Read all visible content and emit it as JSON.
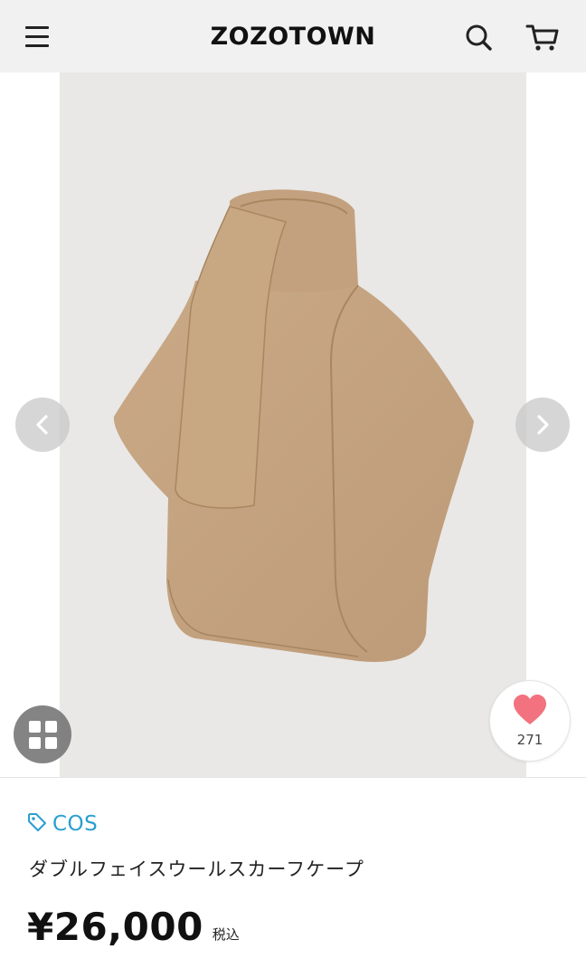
{
  "header": {
    "logo": "ZOZOTOWN",
    "menu_icon": "hamburger-menu-icon",
    "search_icon": "search-icon",
    "cart_icon": "cart-icon"
  },
  "gallery": {
    "prev_icon": "chevron-left-icon",
    "next_icon": "chevron-right-icon",
    "grid_icon": "grid-icon",
    "favorite_icon": "heart-icon",
    "favorite_count": "271",
    "photo_background": "#e9e8e6",
    "garment_color": "#c5a583"
  },
  "product": {
    "brand_icon": "tag-icon",
    "brand": "COS",
    "brand_color": "#2a9fd0",
    "name": "ダブルフェイスウールスカーフケープ",
    "price": "¥26,000",
    "tax_label": "税込"
  }
}
